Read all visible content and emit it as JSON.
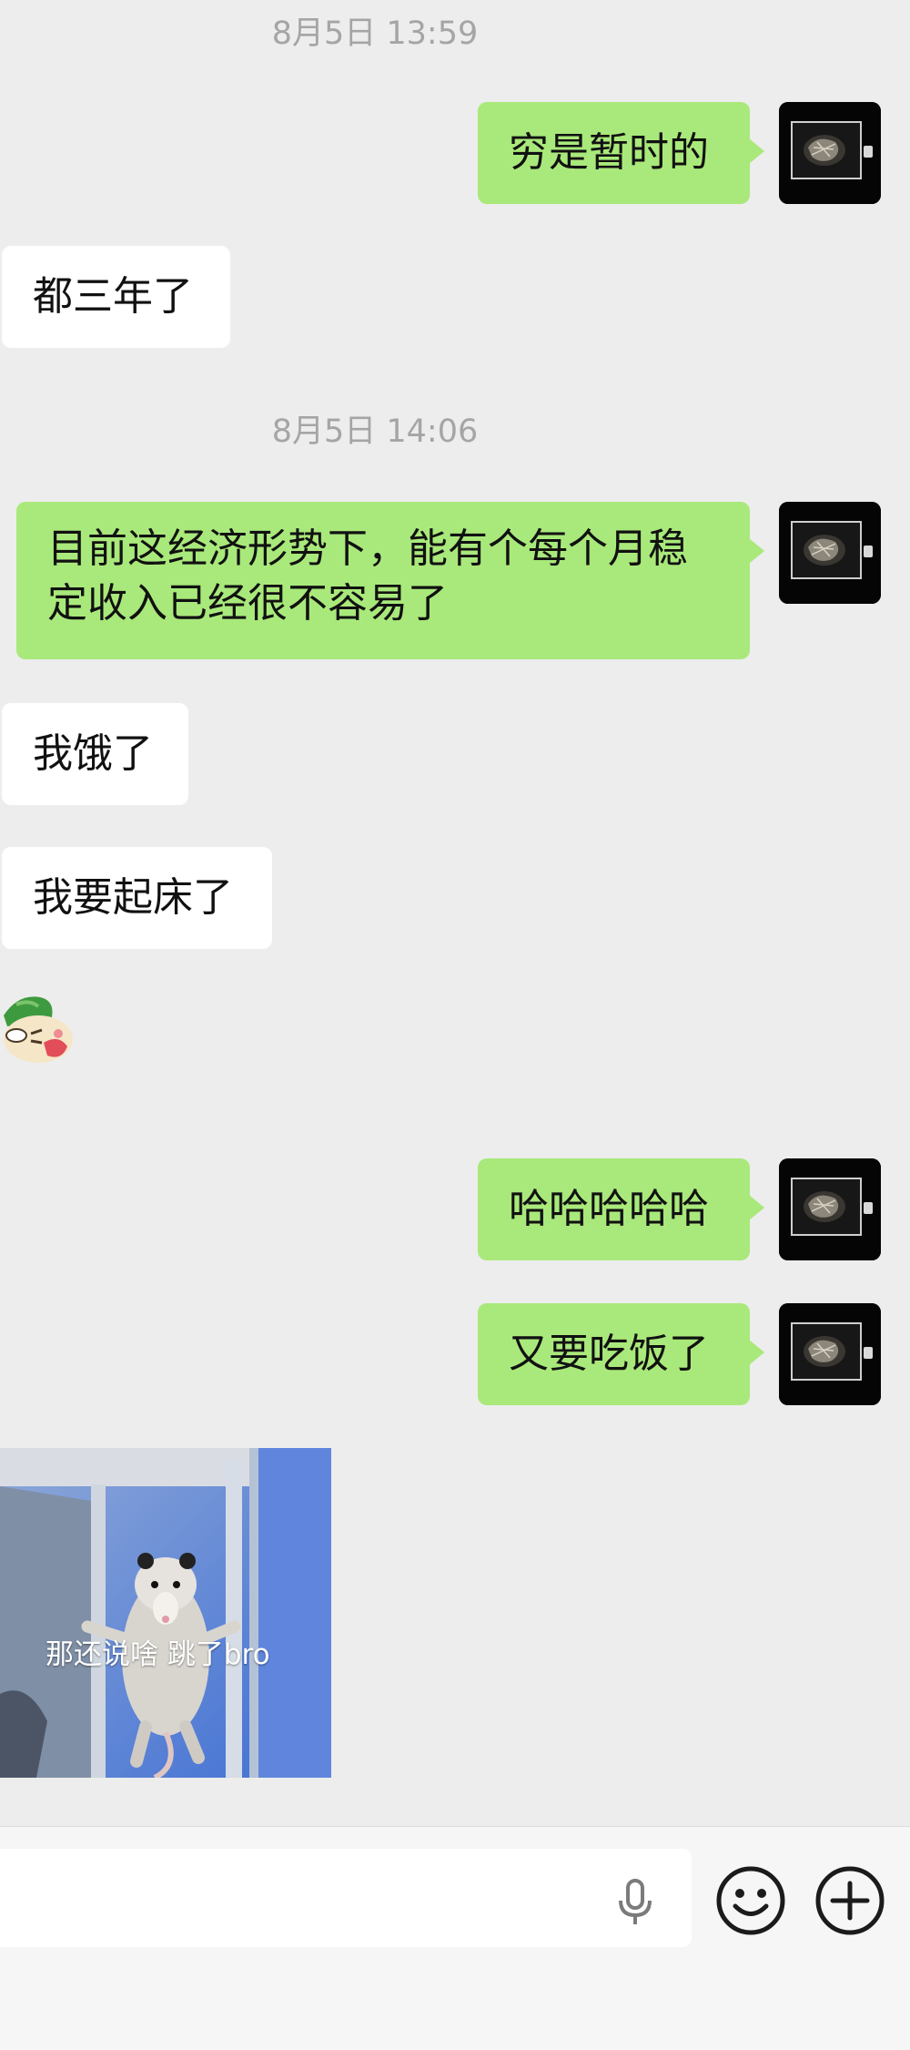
{
  "chat": {
    "timestamp_1": "8月5日 13:59",
    "timestamp_2": "8月5日 14:06",
    "msg_1": "穷是暂时的",
    "msg_2": "都三年了",
    "msg_3": "目前这经济形势下，能有个每个月稳定收入已经很不容易了",
    "msg_4": "我饿了",
    "msg_5": "我要起床了",
    "msg_6": "哈哈哈哈哈",
    "msg_7": "又要吃饭了",
    "sticker_caption": "那还说啥 跳了bro"
  },
  "input_bar": {
    "voice_icon": "microphone-icon",
    "emoji_icon": "smile-emoji-icon",
    "add_icon": "plus-circle-icon"
  },
  "colors": {
    "background": "#ededed",
    "my_bubble": "#a9e97b",
    "their_bubble": "#ffffff",
    "timestamp": "#a5a5a5"
  }
}
